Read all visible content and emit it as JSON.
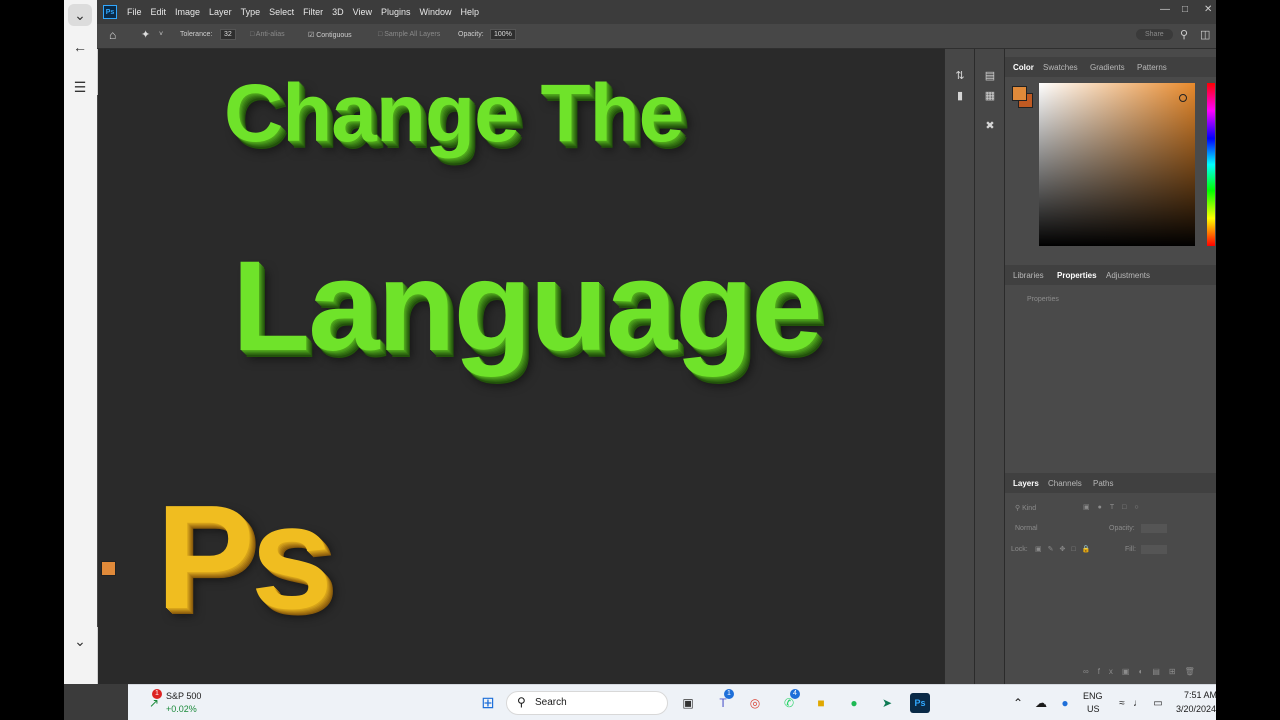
{
  "menu": {
    "logo": "Ps",
    "items": [
      "File",
      "Edit",
      "Image",
      "Layer",
      "Type",
      "Select",
      "Filter",
      "3D",
      "View",
      "Plugins",
      "Window",
      "Help"
    ]
  },
  "options": {
    "tolerance_label": "Tolerance:",
    "tolerance_value": "32",
    "anti_alias": "Anti-alias",
    "contiguous": "Contiguous",
    "sample_all": "Sample All Layers",
    "opacity_label": "Opacity:",
    "opacity_value": "100%",
    "share": "Share"
  },
  "canvas": {
    "line1": "Change The",
    "line2": "Language",
    "ps_text": "Ps"
  },
  "color_panel": {
    "tabs": [
      "Color",
      "Swatches",
      "Gradients",
      "Patterns"
    ],
    "fg": "#e08a3a",
    "bg": "#c05a22"
  },
  "properties_panel": {
    "tabs": [
      "Libraries",
      "Properties",
      "Adjustments"
    ],
    "subtitle": "Properties"
  },
  "layers_panel": {
    "tabs": [
      "Layers",
      "Channels",
      "Paths"
    ],
    "search": "Kind",
    "blend": "Normal",
    "opacity": "Opacity:",
    "lock": "Lock:",
    "fill": "Fill:"
  },
  "taskbar": {
    "stock_name": "S&P 500",
    "stock_change": "+0.02%",
    "stock_badge": "1",
    "search": "Search",
    "teams_badge": "1",
    "whatsapp_badge": "4",
    "lang1": "ENG",
    "lang2": "US",
    "time": "7:51 AM",
    "date": "3/20/2024"
  },
  "colors": {
    "accent_green": "#6fe32a",
    "ps_blue": "#31a8ff",
    "gold": "#f0bd20"
  }
}
